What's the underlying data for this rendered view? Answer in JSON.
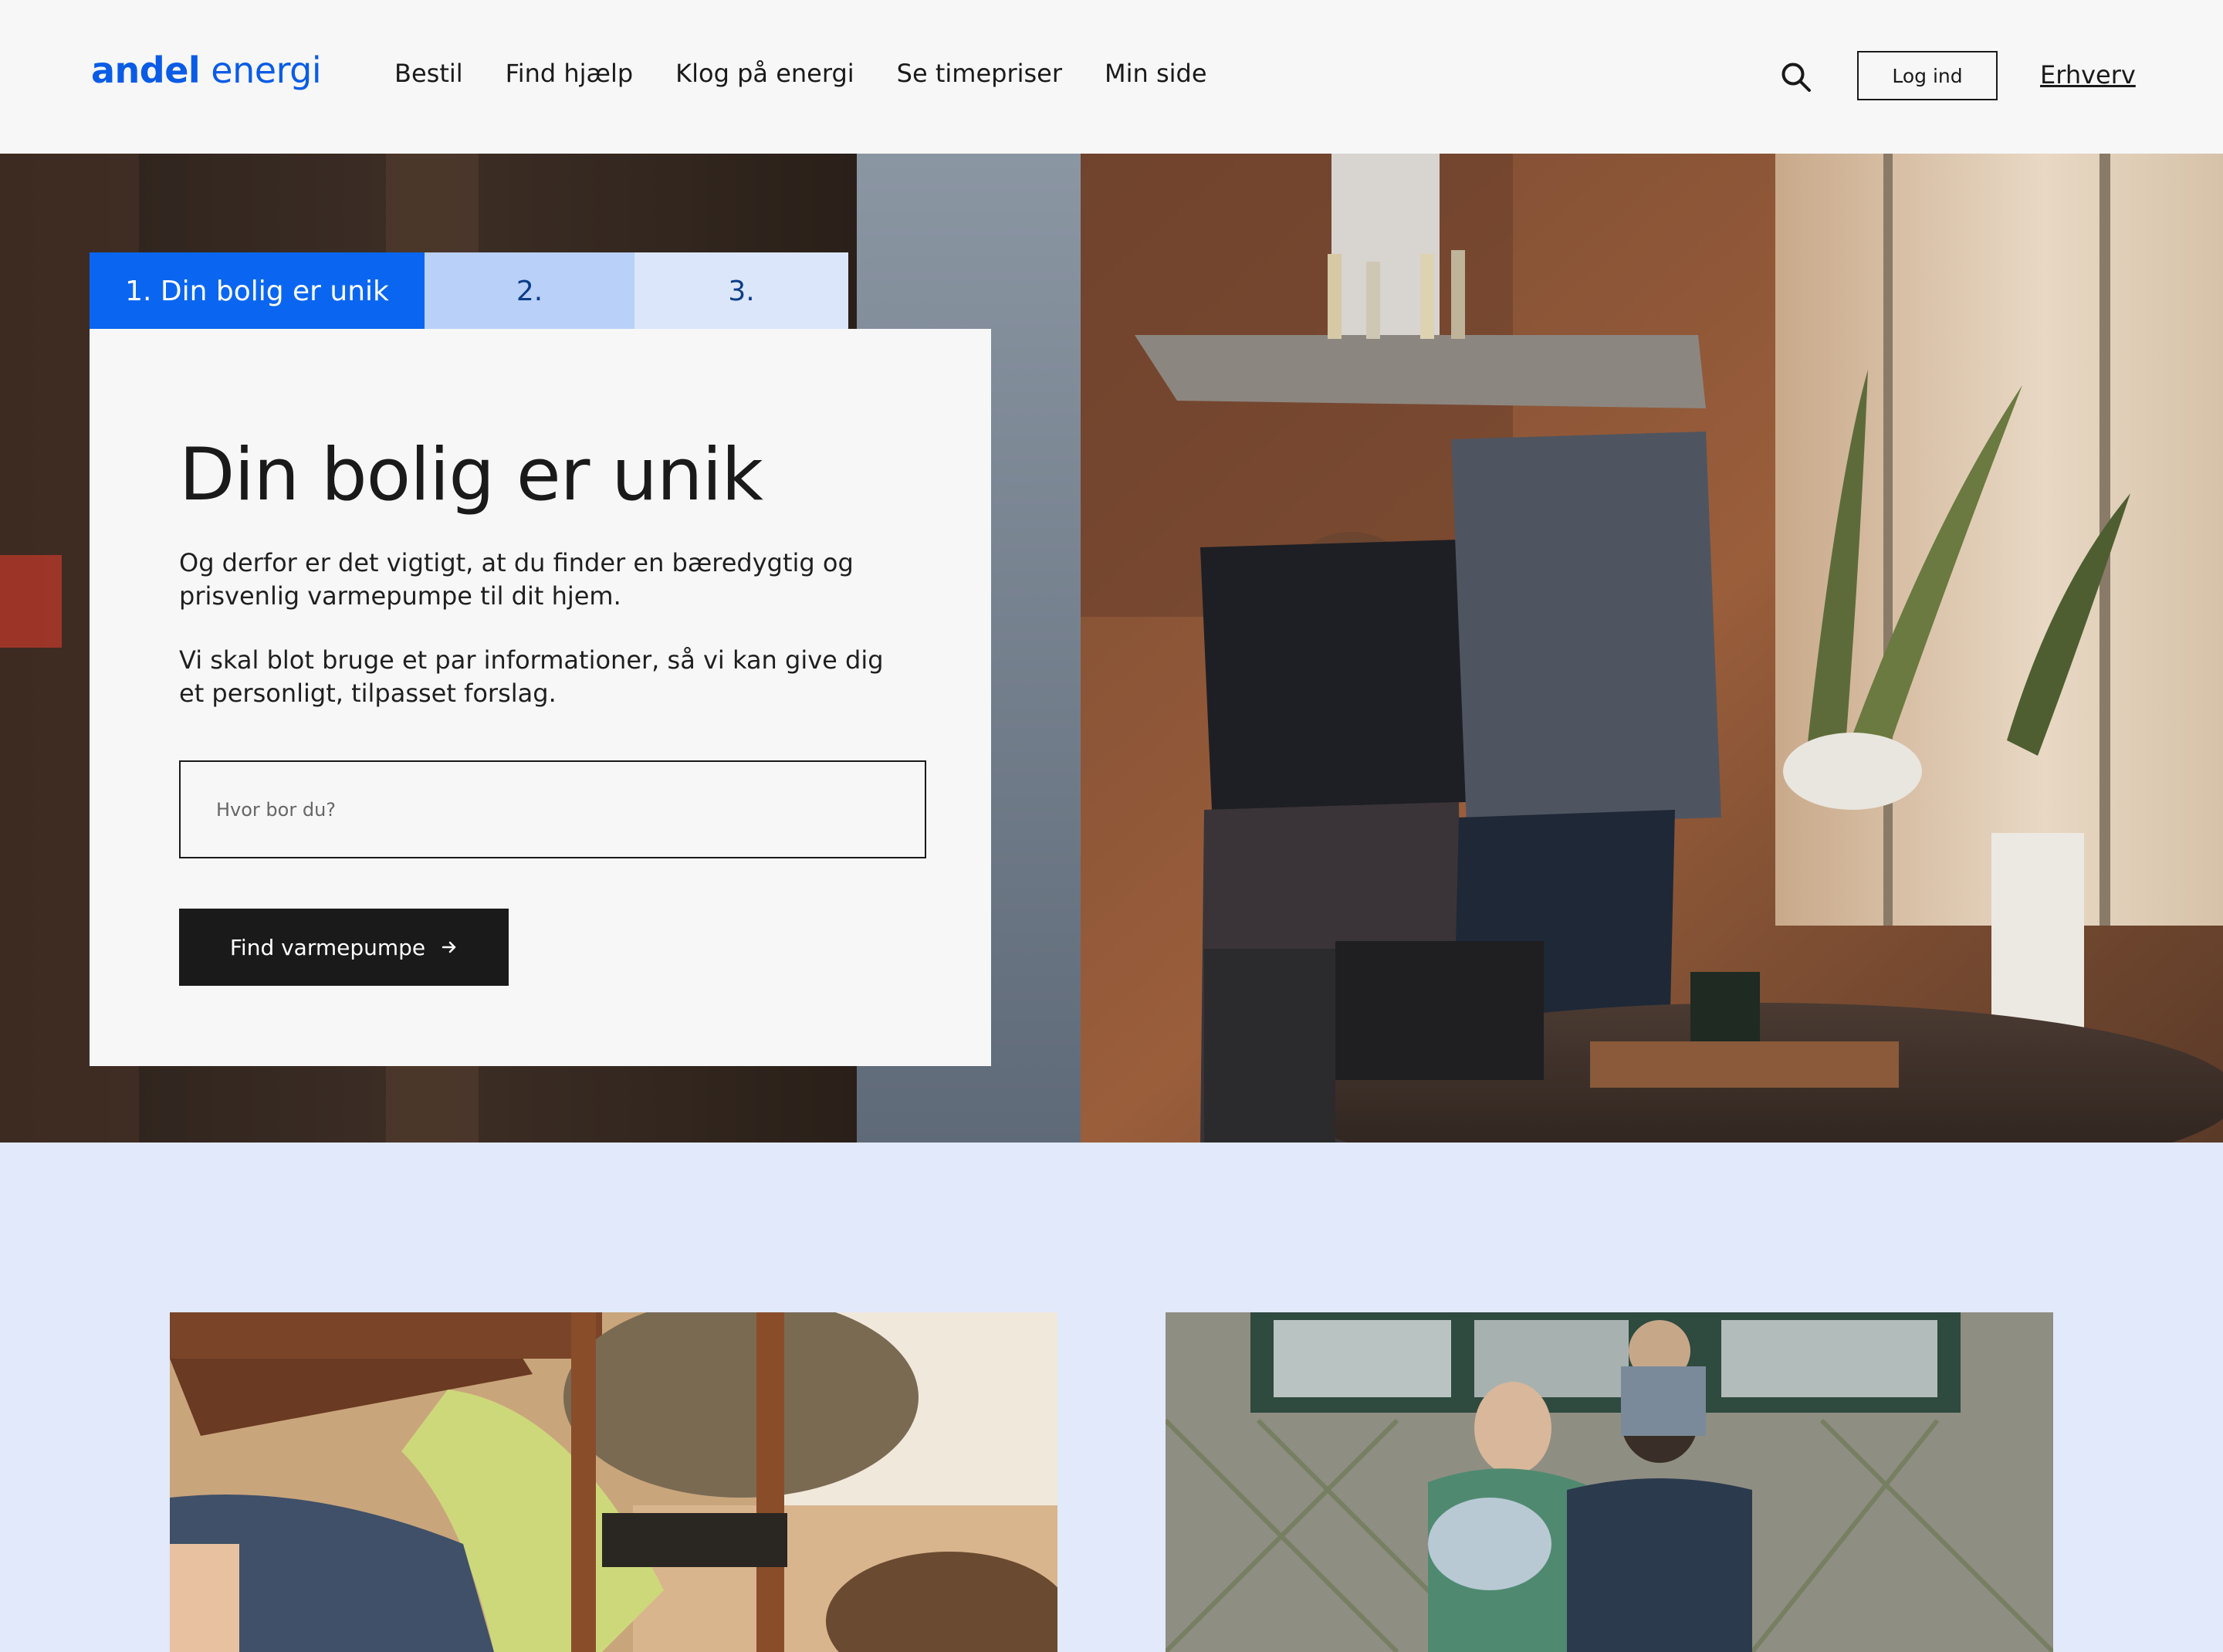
{
  "brand": {
    "name_bold": "andel",
    "name_light": " energi",
    "color": "#0a5ce6"
  },
  "nav": {
    "items": [
      {
        "label": "Bestil"
      },
      {
        "label": "Find hjælp"
      },
      {
        "label": "Klog på energi"
      },
      {
        "label": "Se timepriser"
      },
      {
        "label": "Min side"
      }
    ],
    "search_icon": "search-icon",
    "login_label": "Log ind",
    "business_label": "Erhverv"
  },
  "steps": {
    "tabs": [
      {
        "label": "1. Din bolig er unik",
        "active": true
      },
      {
        "label": "2.",
        "active": false
      },
      {
        "label": "3.",
        "active": false
      }
    ]
  },
  "card": {
    "title": "Din bolig er unik",
    "paragraph_1": "Og derfor er det vigtigt, at du finder en bæredygtig og prisvenlig varmepumpe til dit hjem.",
    "paragraph_2": "Vi skal blot bruge et par informationer,  så vi kan give dig et personligt, tilpasset forslag.",
    "input_value": "",
    "input_placeholder": "Hvor bor du?",
    "button_label": "Find varmepumpe",
    "button_icon": "arrow-right-icon"
  },
  "colors": {
    "accent": "#0a66f0",
    "tab_2": "#b9d0f8",
    "tab_3": "#dbe6fb",
    "section_bg": "#e1e9fb",
    "dark": "#1a1a1a"
  }
}
